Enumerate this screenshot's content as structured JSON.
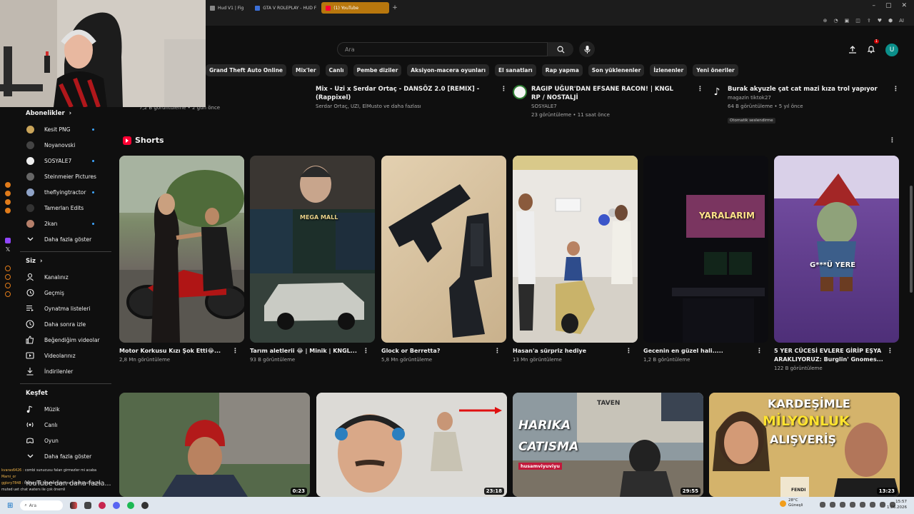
{
  "browser": {
    "tabs": [
      {
        "label": "Hud V1 | Fig",
        "color": "#888"
      },
      {
        "label": "GTA V ROLEPLAY - HUD F",
        "color": "#3b6fd6"
      },
      {
        "label": "(1) YouTube",
        "color": "#ff0033"
      }
    ],
    "new_tab": "+",
    "toolbar_ai": "AI"
  },
  "search": {
    "placeholder": "Ara"
  },
  "header": {
    "notification_count": "1",
    "avatar_letter": "U"
  },
  "chips": [
    "Grand Theft Auto Online",
    "Mix'ler",
    "Canlı",
    "Pembe diziler",
    "Aksiyon-macera oyunları",
    "El sanatları",
    "Rap yapma",
    "Son yüklenenler",
    "İzlenenler",
    "Yeni öneriler"
  ],
  "top_videos": [
    {
      "title": "Mix - Uzi x Serdar Ortaç - DANSÖZ 2.0  [REMIX] - (Rappixel)",
      "meta1": "Serdar Ortaç, UZI, ElMusto ve daha fazlası",
      "meta2": ""
    },
    {
      "title": "RAGIP UĞUR'DAN EFSANE RACON! | KNGL RP / NOSTALJİ",
      "meta1": "SOSYALE7",
      "meta2": "23 görüntüleme • 11 saat önce"
    },
    {
      "title": "Burak akyuzle çat cat mazi kıza trol yapıyor",
      "meta1": "magazin tiktok27",
      "meta2": "64 B görüntüleme • 5 yıl önce",
      "badge": "Otomatik seslendirme"
    }
  ],
  "partial_meta": "7,2 B görüntüleme • 2 gün önce",
  "sidebar": {
    "subs_header": "Abonelikler",
    "subs": [
      {
        "label": "Kesit PNG",
        "dot": true,
        "color": "#c9a45a"
      },
      {
        "label": "Noyanovski",
        "dot": false,
        "color": "#444"
      },
      {
        "label": "SOSYALE7",
        "dot": true,
        "color": "#eee"
      },
      {
        "label": "Steinmeier Pictures",
        "dot": false,
        "color": "#666"
      },
      {
        "label": "theflyingtractor",
        "dot": true,
        "color": "#8fa3c7"
      },
      {
        "label": "Tamerlan Edits",
        "dot": false,
        "color": "#333"
      },
      {
        "label": "2kan",
        "dot": true,
        "color": "#b57f6a"
      }
    ],
    "subs_more": "Daha fazla göster",
    "you_header": "Siz",
    "you": [
      "Kanalınız",
      "Geçmiş",
      "Oynatma listeleri",
      "Daha sonra izle",
      "Beğendiğim videolar",
      "Videolarınız",
      "İndirilenler"
    ],
    "explore_header": "Keşfet",
    "explore": [
      "Müzik",
      "Canlı",
      "Oyun"
    ],
    "explore_more": "Daha fazla göster"
  },
  "shorts": {
    "header": "Shorts",
    "items": [
      {
        "title": "Motor Korkusu Kızı Şok Etti😂...",
        "views": "2,8 Mn görüntüleme"
      },
      {
        "title": "Tarım aletlerii 😂 | Minik | KNGL...",
        "views": "93 B görüntüleme",
        "overlay": "MEGA MALL"
      },
      {
        "title": "Glock or Berretta?",
        "views": "5,8 Mn görüntüleme"
      },
      {
        "title": "Hasan'a sürpriz hediye",
        "views": "13 Mn görüntüleme"
      },
      {
        "title": "Gecenin en güzel hali.....",
        "views": "1,2 B görüntüleme",
        "overlay": "YARALARIM"
      },
      {
        "title": "5 YER CÜCESİ EVLERE GİRİP EŞYA ARAKLIYORUZ: Burglin' Gnomes...",
        "views": "122 B görüntüleme",
        "overlay": "G***Ü YERE"
      }
    ]
  },
  "bottom_videos": [
    {
      "duration": "0:23"
    },
    {
      "duration": "23:18"
    },
    {
      "duration": "29:55",
      "overlay1": "HARIKA",
      "overlay2": "CATISMA",
      "overlay3": "husamviyuviyu",
      "overlay4": "TAVEN"
    },
    {
      "duration": "13:23",
      "overlay1": "KARDEŞİMLE",
      "overlay2": "MİLYONLUK",
      "overlay3": "ALIŞVERİŞ",
      "overlay4": "FENDI"
    }
  ],
  "yt_more": "YouTube'dan daha fazla...",
  "chat": [
    {
      "name": "kvaras6426 :",
      "msg": "combi sunucusu falan girmezler mi acaba"
    },
    {
      "name": "Mami_or",
      "msg": ""
    },
    {
      "name": "gglory7848 :",
      "msg": "tralem hiç hatırlamıyorn ne vardı ki olmayan"
    },
    {
      "name": "",
      "msg": "muted uet chat waters ile çok önemli"
    }
  ],
  "taskbar": {
    "search": "Ara",
    "temp": "28°C",
    "weather": "Güneşli",
    "time": "15:57",
    "date": "1.06.2026"
  }
}
